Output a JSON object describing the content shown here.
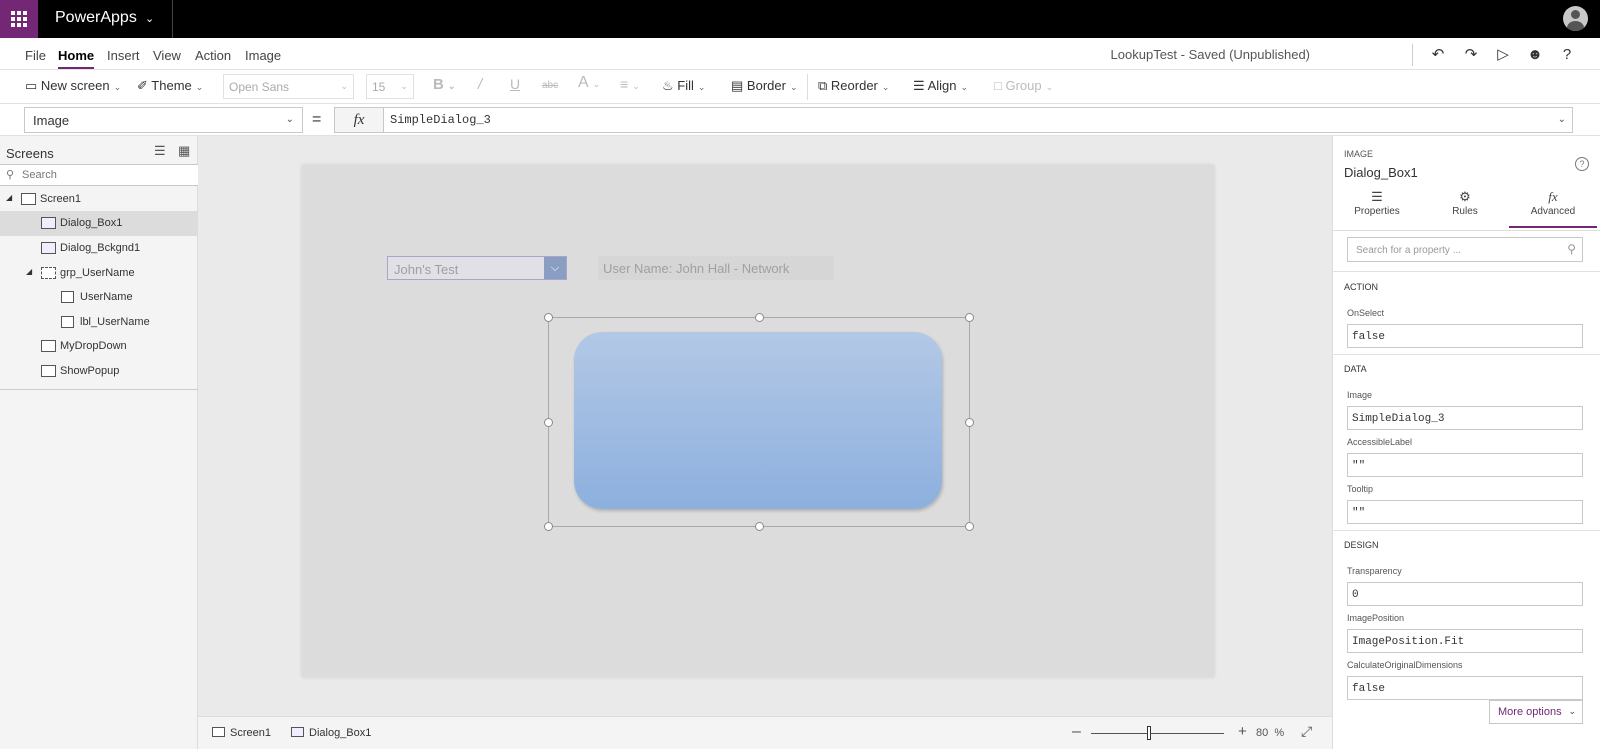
{
  "app": {
    "name": "PowerApps"
  },
  "menu": {
    "items": [
      "File",
      "Home",
      "Insert",
      "View",
      "Action",
      "Image"
    ],
    "active": "Home",
    "saved_status": "LookupTest - Saved (Unpublished)"
  },
  "ribbon": {
    "new_screen": "New screen",
    "theme": "Theme",
    "font": "Open Sans",
    "font_size": "15",
    "bold": "B",
    "italic": "/",
    "underline": "U",
    "strike": "abc",
    "font_color": "A",
    "fill": "Fill",
    "border": "Border",
    "reorder": "Reorder",
    "align": "Align",
    "group": "Group"
  },
  "formula": {
    "property": "Image",
    "fx": "fx",
    "value": "SimpleDialog_3"
  },
  "left_pane": {
    "title": "Screens",
    "search_placeholder": "Search",
    "tree": [
      {
        "label": "Screen1"
      },
      {
        "label": "Dialog_Box1"
      },
      {
        "label": "Dialog_Bckgnd1"
      },
      {
        "label": "grp_UserName"
      },
      {
        "label": "UserName"
      },
      {
        "label": "lbl_UserName"
      },
      {
        "label": "MyDropDown"
      },
      {
        "label": "ShowPopup"
      }
    ]
  },
  "canvas": {
    "dropdown_value": "John's Test",
    "user_label": "User Name:  John Hall - Network"
  },
  "status": {
    "screen_crumb": "Screen1",
    "control_crumb": "Dialog_Box1",
    "zoom": "80",
    "zoom_unit": "%"
  },
  "right_pane": {
    "type_label": "IMAGE",
    "control_name": "Dialog_Box1",
    "tabs": {
      "properties": "Properties",
      "rules": "Rules",
      "advanced": "Advanced"
    },
    "search_placeholder": "Search for a property ...",
    "sections": {
      "action": "ACTION",
      "data": "DATA",
      "design": "DESIGN"
    },
    "fields": {
      "onselect_label": "OnSelect",
      "onselect_value": "false",
      "image_label": "Image",
      "image_value": "SimpleDialog_3",
      "accessible_label": "AccessibleLabel",
      "accessible_value": "\"\"",
      "tooltip_label": "Tooltip",
      "tooltip_value": "\"\"",
      "transparency_label": "Transparency",
      "transparency_value": "0",
      "imageposition_label": "ImagePosition",
      "imageposition_value": "ImagePosition.Fit",
      "calc_label": "CalculateOriginalDimensions",
      "calc_value": "false"
    },
    "more_options": "More options"
  },
  "colors": {
    "brand": "#742774",
    "topbar": "#000000",
    "dialog_top": "#b3c8e6",
    "dialog_bottom": "#8db0de"
  }
}
